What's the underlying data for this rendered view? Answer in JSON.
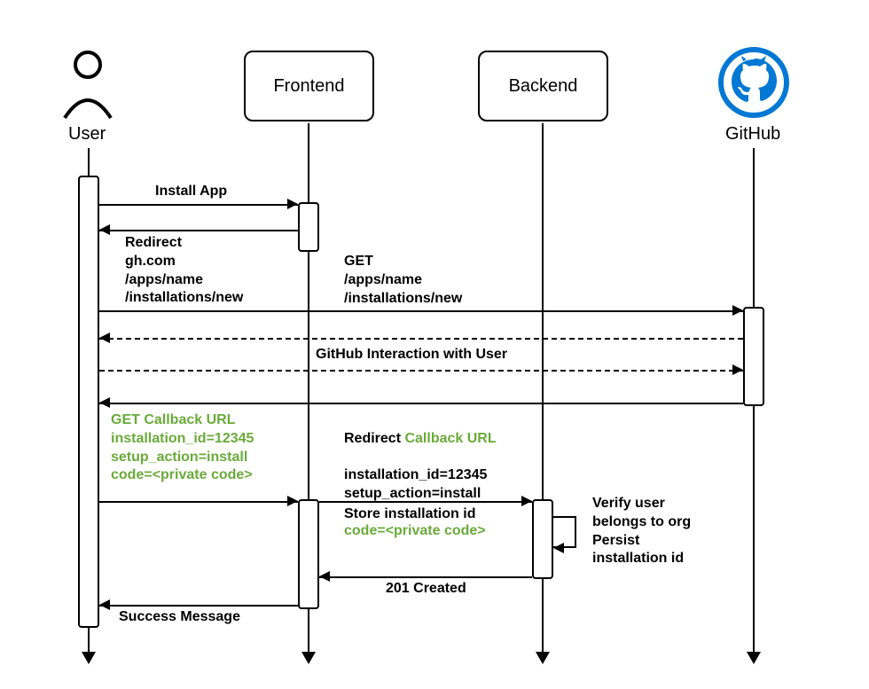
{
  "participants": {
    "user": {
      "label": "User"
    },
    "frontend": {
      "label": "Frontend"
    },
    "backend": {
      "label": "Backend"
    },
    "github": {
      "label": "GitHub"
    }
  },
  "messages": {
    "install_app": "Install App",
    "redirect_new": "Redirect\ngh.com\n/apps/name\n/installations/new",
    "get_new": "GET\n/apps/name\n/installations/new",
    "gh_interaction": "GitHub Interaction with User",
    "get_callback": "GET Callback URL\ninstallation_id=12345\nsetup_action=install\ncode=<private code>",
    "redirect_callback_prefix": "Redirect ",
    "redirect_callback_urltext": "Callback URL",
    "redirect_callback_rest": "installation_id=12345\nsetup_action=install",
    "redirect_callback_code": "code=<private code>",
    "store_id": "Store installation id",
    "self_note": "Verify user\nbelongs to org\nPersist\ninstallation id",
    "created": "201 Created",
    "success": "Success Message"
  },
  "colors": {
    "accent_green": "#6aaa3a",
    "github_blue": "#0078d4"
  }
}
